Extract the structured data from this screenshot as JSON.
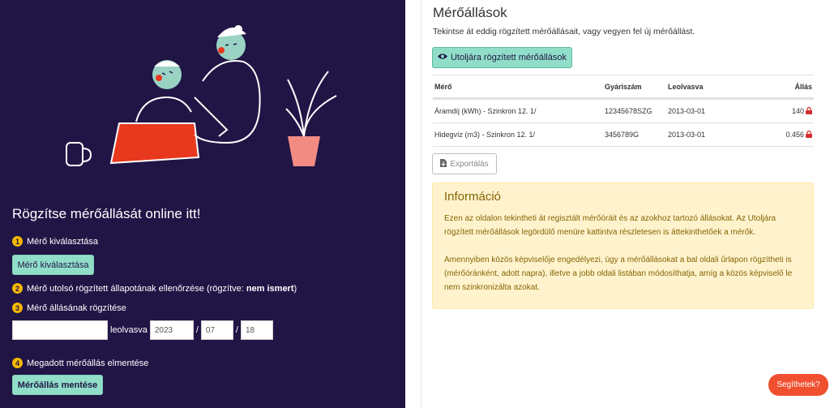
{
  "left": {
    "title": "Rögzítse mérőállását online itt!",
    "steps": [
      {
        "num": "1",
        "text": "Mérő kiválasztása"
      },
      {
        "num": "2",
        "text": "Mérő utolsó rögzített állapotának ellenőrzése (rögzítve:",
        "bold": "nem ismert",
        "suffix": ")"
      },
      {
        "num": "3",
        "text": "Mérő állásának rögzítése"
      },
      {
        "num": "4",
        "text": "Megadott mérőállás elmentése"
      }
    ],
    "select_meter_button": "Mérő kiválasztása",
    "reading": {
      "value": "",
      "label": "leolvasva",
      "year": "2023",
      "month": "07",
      "day": "18",
      "sep": "/"
    },
    "save_button": "Mérőállás mentése"
  },
  "right": {
    "title": "Mérőállások",
    "description": "Tekintse át eddig rögzített mérőállásait, vagy vegyen fel új mérőállást.",
    "last_button": "Utoljára rögzített mérőállások",
    "table": {
      "headers": [
        "Mérő",
        "Gyáriszám",
        "Leolvasva",
        "Állás"
      ],
      "rows": [
        {
          "meter": "Áramdíj (kWh) - Szinkron 12. 1/",
          "serial": "12345678SZG",
          "date": "2013-03-01",
          "value": "140"
        },
        {
          "meter": "Hidegvíz (m3) - Szinkron 12. 1/",
          "serial": "3456789G",
          "date": "2013-03-01",
          "value": "0.456"
        }
      ]
    },
    "export_button": "Exportálás",
    "info": {
      "title": "Információ",
      "p1": "Ezen az oldalon tekintheti át regisztált mérőóráit és az azokhoz tartozó állásokat. Az Utoljára rögzített mérőállások legördülő menüre kattintva részletesen is áttekinthetőek a mérők.",
      "p2": "Amennyiben közös képviselője engedélyezi, úgy a mérőállásokat a bal oldali űrlapon rögzítheti is (mérőóránként, adott napra), illetve a jobb oldali listában módosíthatja, amíg a közös képviselő le nem szinkronizálta azokat."
    }
  },
  "help_button": "Segíthetek?",
  "colors": {
    "left_bg": "#211546",
    "mint": "#90dec8",
    "accent_yellow": "#f5b800",
    "help_orange": "#f05030",
    "info_bg": "#fff3cd"
  }
}
